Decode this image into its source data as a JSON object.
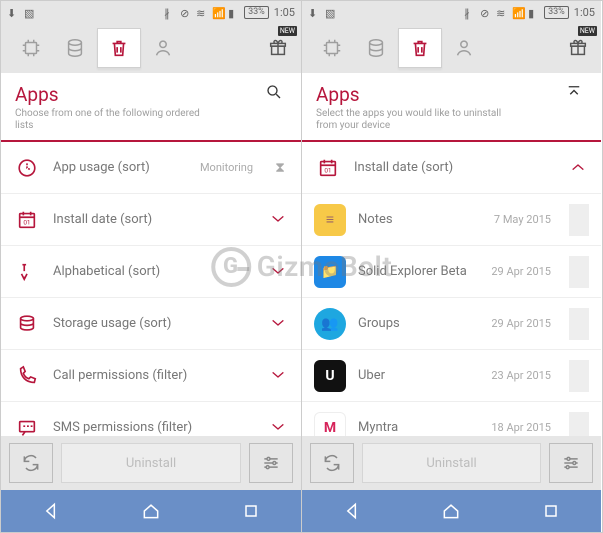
{
  "status": {
    "battery": "33%",
    "time": "1:05"
  },
  "left": {
    "header": {
      "title": "Apps",
      "subtitle": "Choose from one of the following ordered lists"
    },
    "rows": [
      {
        "label": "App usage (sort)",
        "meta": "Monitoring",
        "hourglass": true,
        "chev": false
      },
      {
        "label": "Install date (sort)",
        "meta": "",
        "hourglass": false,
        "chev": true
      },
      {
        "label": "Alphabetical (sort)",
        "meta": "",
        "hourglass": false,
        "chev": true
      },
      {
        "label": "Storage usage (sort)",
        "meta": "",
        "hourglass": false,
        "chev": true
      },
      {
        "label": "Call permissions (filter)",
        "meta": "",
        "hourglass": false,
        "chev": true
      },
      {
        "label": "SMS permissions (filter)",
        "meta": "",
        "hourglass": false,
        "chev": true
      }
    ],
    "uninstall": "Uninstall"
  },
  "right": {
    "header": {
      "title": "Apps",
      "subtitle": "Select the apps you would like to uninstall from your device"
    },
    "sort_row": {
      "label": "Install date (sort)"
    },
    "apps": [
      {
        "name": "Notes",
        "date": "7 May 2015",
        "color": "#f7c948",
        "glyph": "≡"
      },
      {
        "name": "Solid Explorer Beta",
        "date": "29 Apr 2015",
        "color": "#1e88e5",
        "glyph": "📁"
      },
      {
        "name": "Groups",
        "date": "29 Apr 2015",
        "color": "#1ea7e0",
        "glyph": "👥"
      },
      {
        "name": "Uber",
        "date": "23 Apr 2015",
        "color": "#111111",
        "glyph": "U"
      },
      {
        "name": "Myntra",
        "date": "18 Apr 2015",
        "color": "#ffffff",
        "glyph": "M"
      }
    ],
    "uninstall": "Uninstall"
  },
  "gift_badge": "NEW",
  "watermark": "GizmoBolt"
}
